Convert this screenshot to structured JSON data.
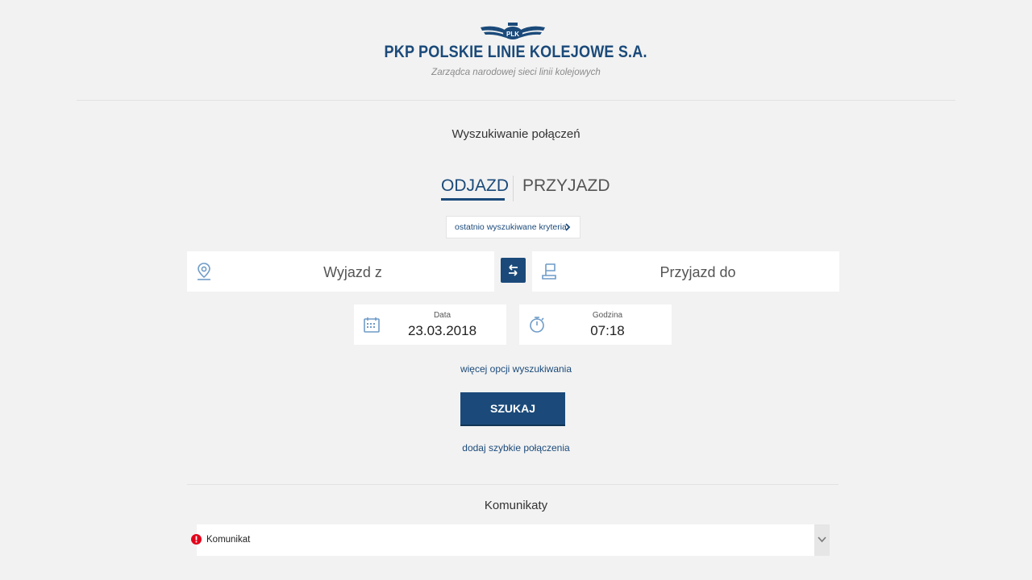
{
  "header": {
    "brand_name": "PKP POLSKIE LINIE KOLEJOWE S.A.",
    "tagline": "Zarządca narodowej sieci linii kolejowych",
    "logo_icon": "plk-winged-emblem"
  },
  "search": {
    "heading": "Wyszukiwanie połączeń",
    "tabs": [
      {
        "label": "ODJAZD",
        "active": true
      },
      {
        "label": "PRZYJAZD",
        "active": false
      }
    ],
    "recent_criteria_label": "ostatnio wyszukiwane kryteria",
    "from_placeholder": "Wyjazd z",
    "to_placeholder": "Przyjazd do",
    "date_label": "Data",
    "date_value": "23.03.2018",
    "time_label": "Godzina",
    "time_value": "07:18",
    "more_options_label": "więcej opcji wyszukiwania",
    "search_button_label": "SZUKAJ",
    "quick_connections_label": "dodaj szybkie połączenia"
  },
  "notices": {
    "heading": "Komunikaty",
    "item_label": "Komunikat"
  },
  "colors": {
    "brand": "#1b4a7a",
    "background": "#f2f2f2",
    "alert": "#e3001b"
  }
}
